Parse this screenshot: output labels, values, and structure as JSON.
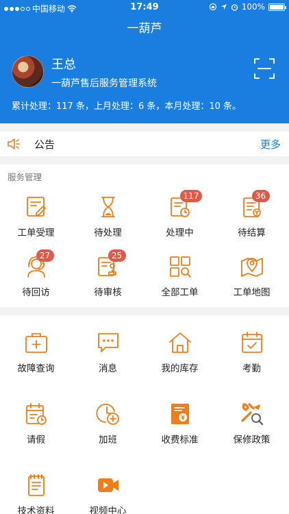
{
  "status_bar": {
    "carrier": "中国移动",
    "time": "17:49",
    "battery": "100%",
    "battery_level": 1.0
  },
  "nav": {
    "title": "一葫芦"
  },
  "profile": {
    "name": "王总",
    "subtitle": "一葫芦售后服务管理系统",
    "stats": "累计处理：117 条，上月处理：6 条，本月处理：10 条。"
  },
  "notice": {
    "title": "公告",
    "more": "更多"
  },
  "service": {
    "header": "服务管理",
    "items": [
      {
        "label": "工单受理",
        "icon": "form-edit-icon",
        "badge": ""
      },
      {
        "label": "待处理",
        "icon": "hourglass-icon",
        "badge": ""
      },
      {
        "label": "处理中",
        "icon": "clipboard-clock-icon",
        "badge": "117"
      },
      {
        "label": "待结算",
        "icon": "bill-icon",
        "badge": "36"
      },
      {
        "label": "待回访",
        "icon": "headset-agent-icon",
        "badge": "27"
      },
      {
        "label": "待审核",
        "icon": "stamp-form-icon",
        "badge": "25"
      },
      {
        "label": "全部工单",
        "icon": "grid-search-icon",
        "badge": ""
      },
      {
        "label": "工单地图",
        "icon": "map-pin-icon",
        "badge": ""
      }
    ]
  },
  "tools": {
    "items": [
      {
        "label": "故障查询",
        "icon": "toolbox-icon"
      },
      {
        "label": "消息",
        "icon": "chat-bubble-icon"
      },
      {
        "label": "我的库存",
        "icon": "home-icon"
      },
      {
        "label": "考勤",
        "icon": "calendar-check-icon"
      },
      {
        "label": "请假",
        "icon": "calendar-clock-icon"
      },
      {
        "label": "加班",
        "icon": "clock-plus-icon"
      },
      {
        "label": "收费标准",
        "icon": "yen-doc-icon"
      },
      {
        "label": "保修政策",
        "icon": "wrench-search-icon"
      },
      {
        "label": "技术资料",
        "icon": "notepad-icon"
      },
      {
        "label": "视频中心",
        "icon": "video-camera-icon"
      }
    ]
  },
  "colors": {
    "brand": "#1a7ee0",
    "accent": "#ee7d1a",
    "badge": "#e05a4a",
    "link": "#1a7ee0"
  }
}
